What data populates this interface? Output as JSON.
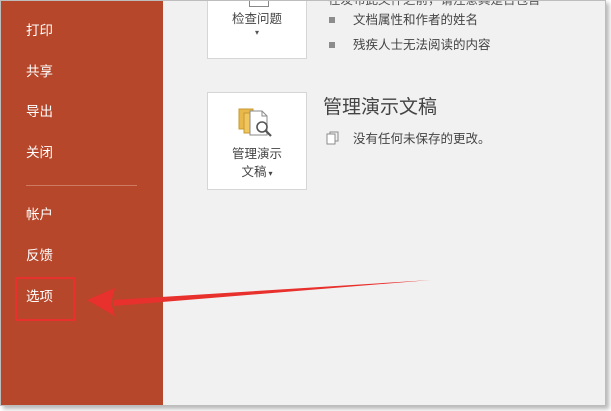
{
  "sidebar": {
    "items": [
      {
        "key": "print",
        "label": "打印"
      },
      {
        "key": "share",
        "label": "共享"
      },
      {
        "key": "export",
        "label": "导出"
      },
      {
        "key": "close",
        "label": "关闭"
      },
      {
        "key": "account",
        "label": "帐户"
      },
      {
        "key": "feedback",
        "label": "反馈"
      },
      {
        "key": "options",
        "label": "选项"
      }
    ]
  },
  "inspect": {
    "button_label": "检查问题",
    "cut_text": "在发布此文件之前，请注意其是否包含",
    "bullets": [
      "文档属性和作者的姓名",
      "残疾人士无法阅读的内容"
    ]
  },
  "manage": {
    "title": "管理演示文稿",
    "button_label_line1": "管理演示",
    "button_label_line2": "文稿",
    "status": "没有任何未保存的更改。"
  },
  "colors": {
    "sidebar_bg": "#b7472a",
    "annotation_red": "#e8302c",
    "content_bg": "#f1f1f1"
  }
}
